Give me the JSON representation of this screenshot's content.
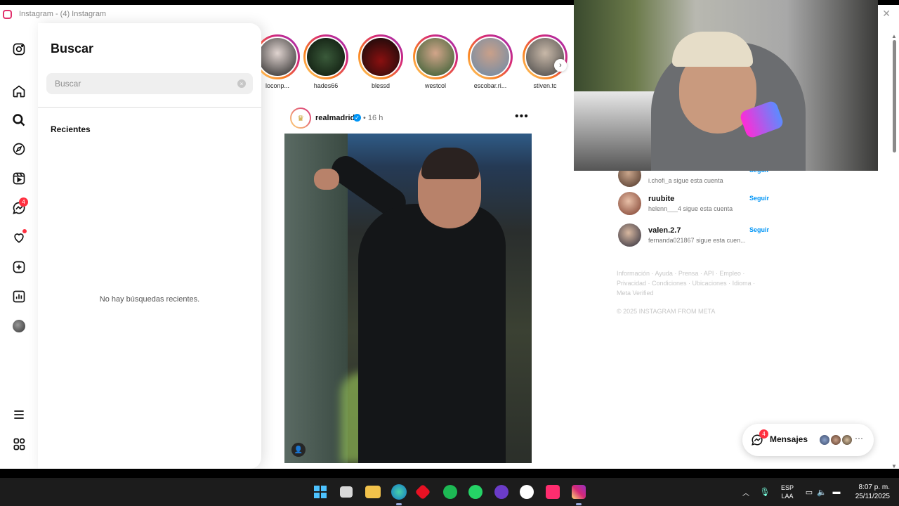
{
  "window": {
    "title": "Instagram - (4) Instagram"
  },
  "nav": {
    "messages_badge": "4"
  },
  "search": {
    "title": "Buscar",
    "placeholder": "Buscar",
    "clear_glyph": "×",
    "recent_label": "Recientes",
    "empty_text": "No hay búsquedas recientes."
  },
  "stories": [
    {
      "name": "loconp..."
    },
    {
      "name": "hades66"
    },
    {
      "name": "blessd"
    },
    {
      "name": "westcol"
    },
    {
      "name": "escobar.ri..."
    },
    {
      "name": "stiven.tc"
    }
  ],
  "post": {
    "username": "realmadrid",
    "separator": "•",
    "time": "16 h",
    "more": "•••"
  },
  "suggestions": [
    {
      "name": "",
      "sub": "i.chofi_a sigue esta cuenta",
      "follow": "Seguir"
    },
    {
      "name": "ruubite",
      "sub": "helenn___4 sigue esta cuenta",
      "follow": "Seguir"
    },
    {
      "name": "valen.2.7",
      "sub": "fernanda021867 sigue esta cuen...",
      "follow": "Seguir"
    }
  ],
  "footer": {
    "links": "Información · Ayuda · Prensa · API · Empleo · Privacidad · Condiciones · Ubicaciones · Idioma · Meta Verified",
    "copyright": "© 2025 INSTAGRAM FROM META"
  },
  "messages": {
    "label": "Mensajes",
    "badge": "4",
    "more": "···"
  },
  "taskbar": {
    "lang_line1": "ESP",
    "lang_line2": "LAA",
    "time": "8:07 p. m.",
    "date": "25/11/2025"
  },
  "colors": {
    "accent": "#0095f6",
    "badge": "#ff3040",
    "taskbar": "#1c1c1c"
  }
}
